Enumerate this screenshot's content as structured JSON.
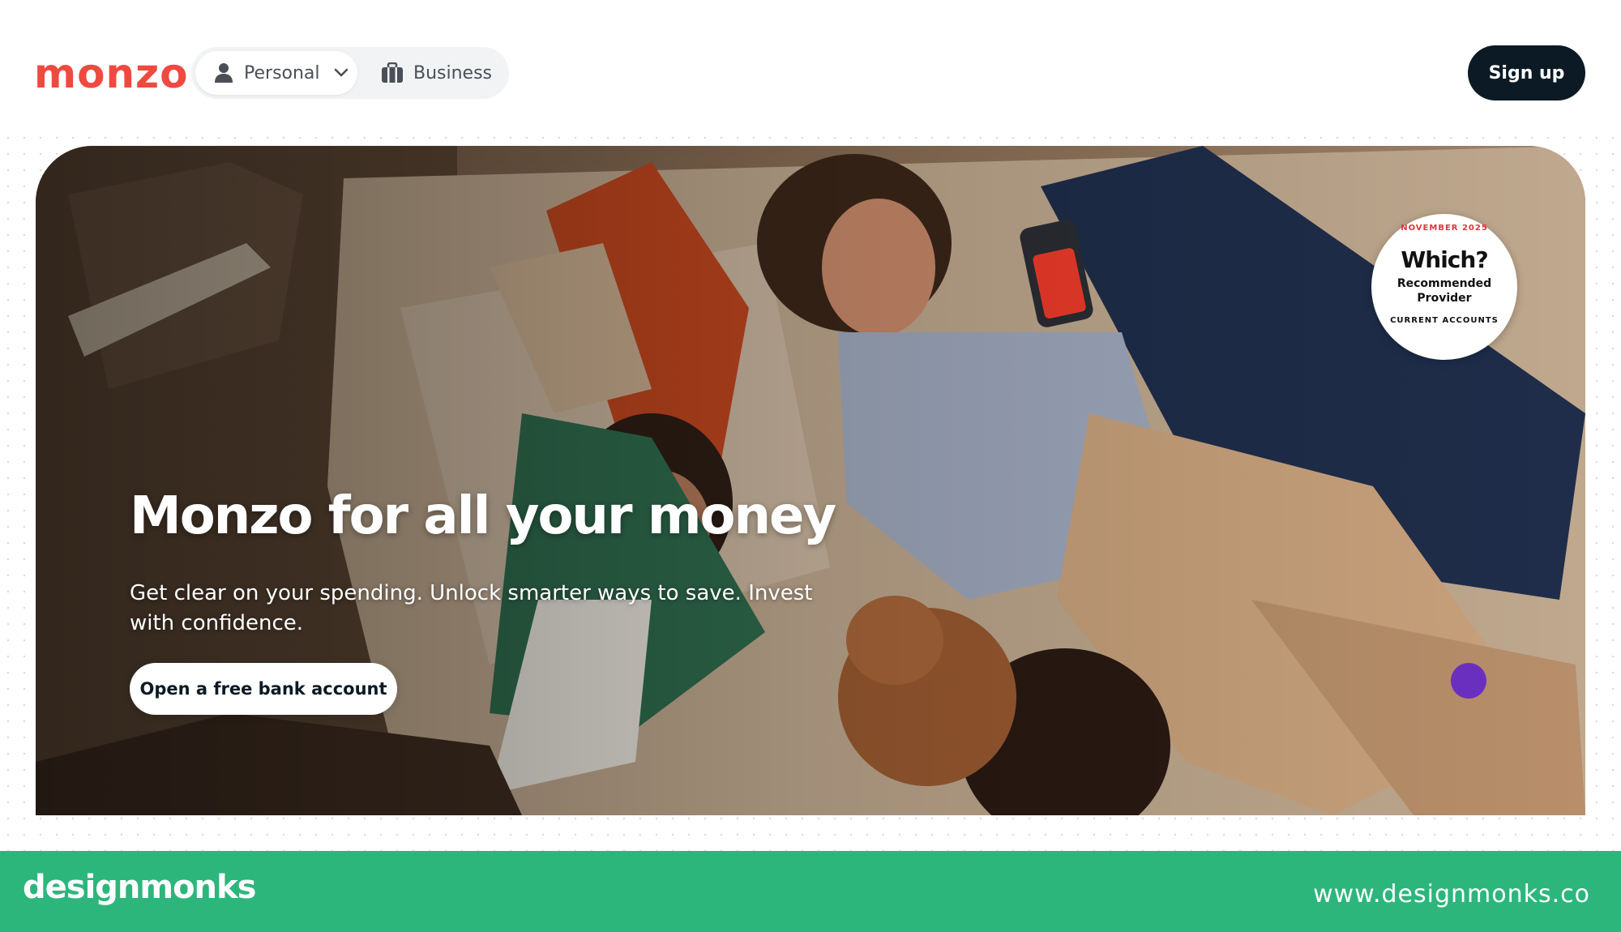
{
  "header": {
    "logo": "monzo",
    "nav": {
      "personal_label": "Personal",
      "business_label": "Business"
    },
    "signup_label": "Sign up"
  },
  "hero": {
    "title": "Monzo for all your money",
    "subtitle": "Get clear on your spending. Unlock smarter ways to save. Invest with confidence.",
    "cta_label": "Open a free bank account",
    "badge": {
      "top_text": "NOVEMBER 2025",
      "brand": "Which?",
      "line1": "Recommended",
      "line2": "Provider",
      "bottom_text": "CURRENT ACCOUNTS"
    }
  },
  "band": {
    "logo": "designmonks",
    "url": "www.designmonks.co"
  },
  "colors": {
    "brand_coral": "#f0493f",
    "dark_navy": "#0b1a24",
    "band_green": "#2db67c"
  },
  "icons": {
    "personal": "person-icon",
    "dropdown": "chevron-down-icon",
    "business": "briefcase-icon"
  }
}
